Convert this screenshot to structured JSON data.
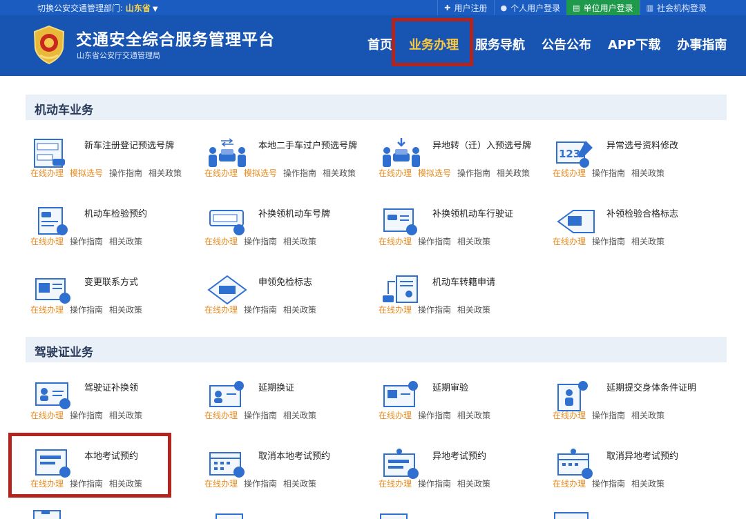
{
  "topbar": {
    "region_prefix": "切换公安交通管理部门: ",
    "region_value": "山东省",
    "links": [
      "用户注册",
      "个人用户登录",
      "单位用户登录",
      "社会机构登录"
    ]
  },
  "header": {
    "title": "交通安全综合服务管理平台",
    "subtitle": "山东省公安厅交通管理局",
    "nav": [
      "首页",
      "业务办理",
      "服务导航",
      "公告公布",
      "APP下载",
      "办事指南"
    ]
  },
  "labels": {
    "online": "在线办理",
    "mock": "模拟选号",
    "guide": "操作指南",
    "policy": "相关政策"
  },
  "sections": {
    "vehicle": "机动车业务",
    "license": "驾驶证业务"
  },
  "vehicle_items": [
    {
      "title": "新车注册登记预选号牌",
      "icon": "plate-form-icon",
      "mock": true
    },
    {
      "title": "本地二手车过户预选号牌",
      "icon": "car-transfer-icon",
      "mock": true
    },
    {
      "title": "异地转（迁）入预选号牌",
      "icon": "car-move-in-icon",
      "mock": true
    },
    {
      "title": "异常选号资料修改",
      "icon": "number-edit-icon",
      "mock": false
    },
    {
      "title": "机动车检验预约",
      "icon": "inspection-booking-icon",
      "mock": false
    },
    {
      "title": "补换领机动车号牌",
      "icon": "plate-replace-icon",
      "mock": false
    },
    {
      "title": "补换领机动车行驶证",
      "icon": "vehicle-license-replace-icon",
      "mock": false
    },
    {
      "title": "补领检验合格标志",
      "icon": "inspection-mark-icon",
      "mock": false
    },
    {
      "title": "变更联系方式",
      "icon": "contact-change-icon",
      "mock": false
    },
    {
      "title": "申领免检标志",
      "icon": "exempt-mark-icon",
      "mock": false
    },
    {
      "title": "机动车转籍申请",
      "icon": "transfer-registry-icon",
      "mock": false
    }
  ],
  "license_items": [
    {
      "title": "驾驶证补换领",
      "icon": "license-replace-icon"
    },
    {
      "title": "延期换证",
      "icon": "license-extend-icon"
    },
    {
      "title": "延期审验",
      "icon": "review-extend-icon"
    },
    {
      "title": "延期提交身体条件证明",
      "icon": "health-cert-extend-icon"
    },
    {
      "title": "本地考试预约",
      "icon": "exam-booking-icon"
    },
    {
      "title": "取消本地考试预约",
      "icon": "cancel-exam-icon"
    },
    {
      "title": "异地考试预约",
      "icon": "remote-exam-booking-icon"
    },
    {
      "title": "取消异地考试预约",
      "icon": "cancel-remote-exam-icon"
    }
  ],
  "colors": {
    "header": "#1855b3",
    "accent": "#ffc93c",
    "highlight": "#b3241d",
    "link_orange": "#e88a1e"
  }
}
